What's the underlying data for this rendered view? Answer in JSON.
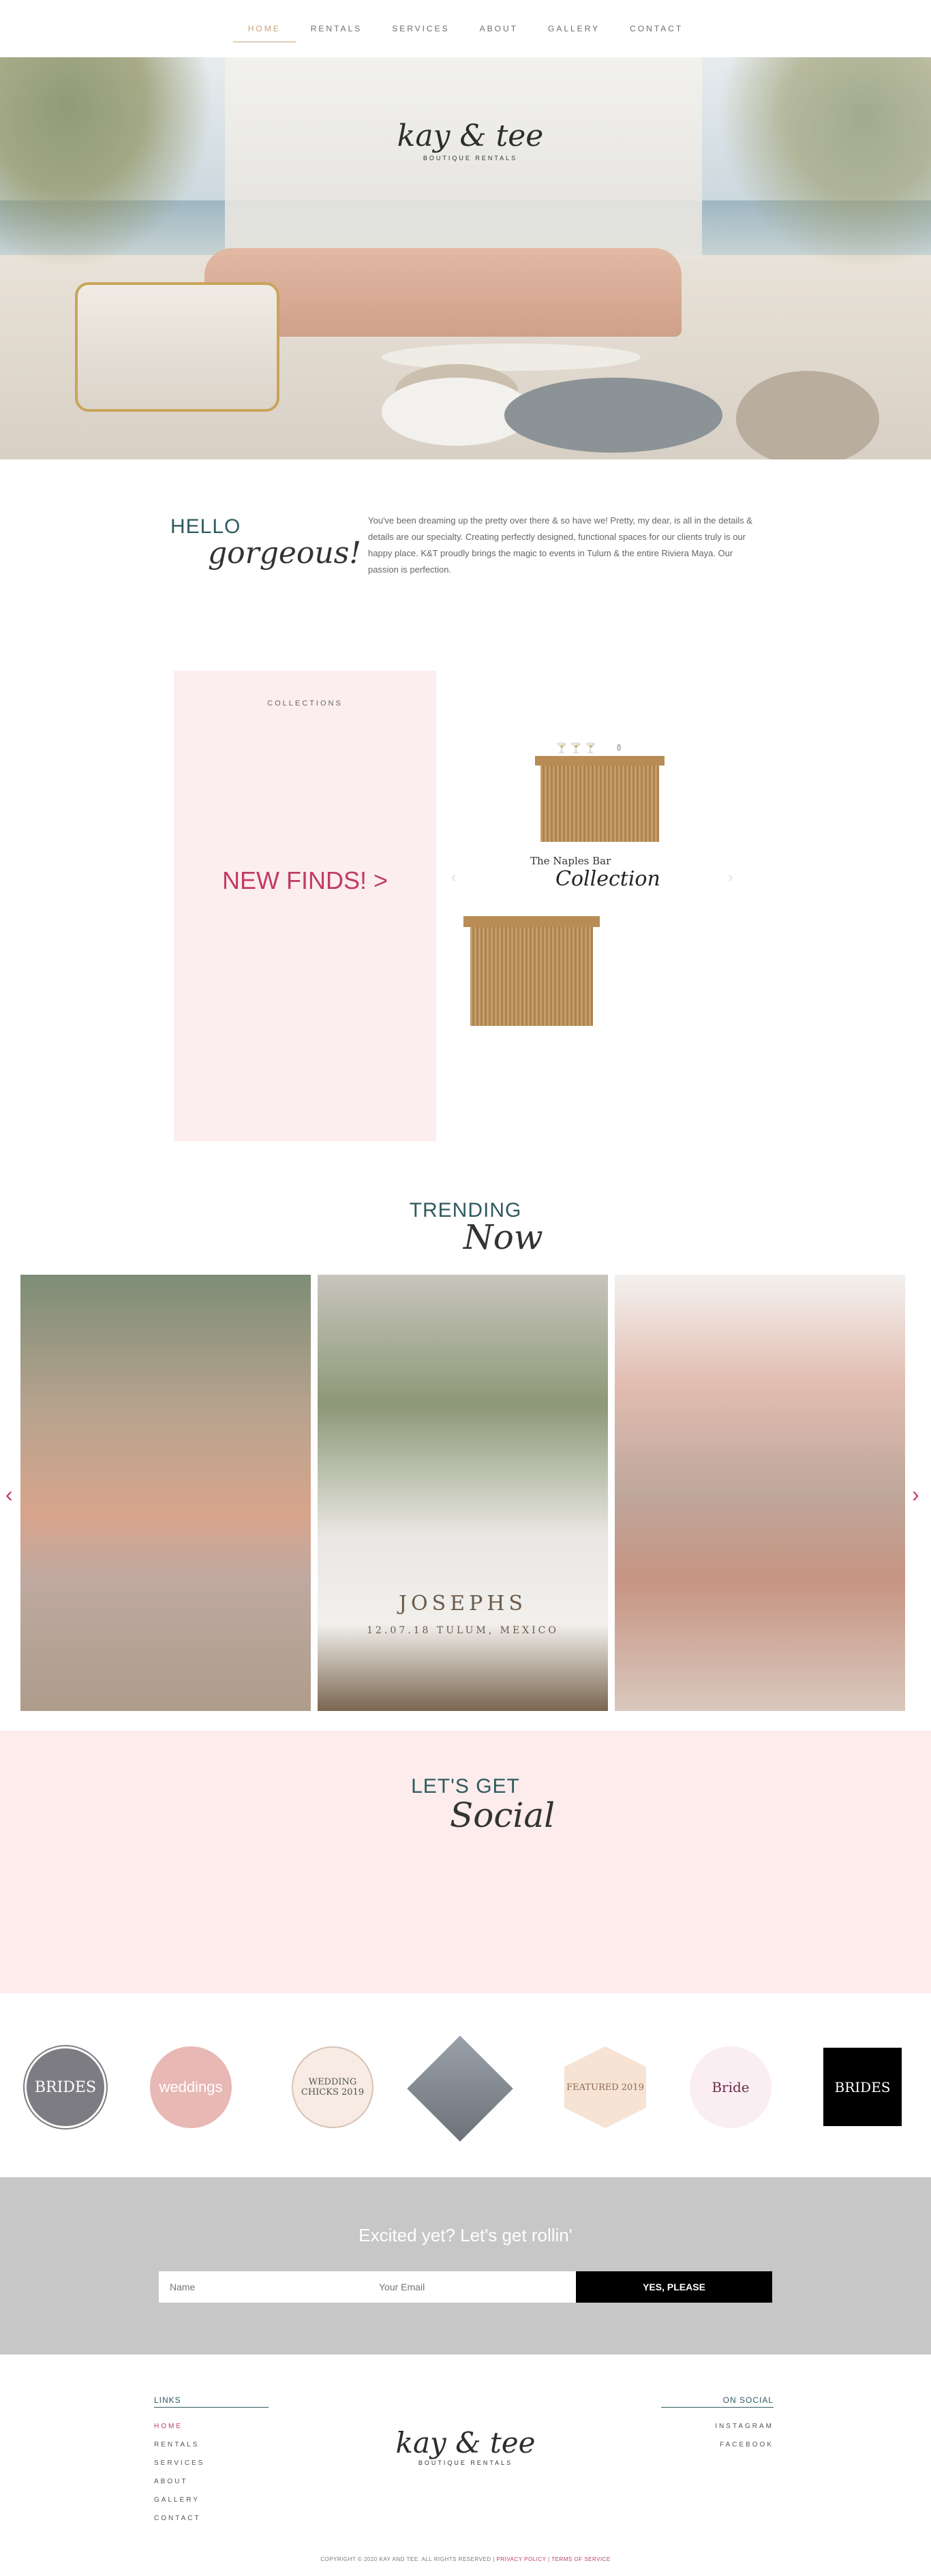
{
  "nav": {
    "items": [
      {
        "label": "HOME",
        "active": true
      },
      {
        "label": "RENTALS"
      },
      {
        "label": "SERVICES"
      },
      {
        "label": "ABOUT"
      },
      {
        "label": "GALLERY"
      },
      {
        "label": "CONTACT"
      }
    ]
  },
  "hero": {
    "logo_script": "kay & tee",
    "logo_sub": "BOUTIQUE RENTALS"
  },
  "hello": {
    "title": "HELLO",
    "script": "gorgeous!",
    "body": "You've been dreaming up the pretty over there & so have we! Pretty, my dear, is all in the details & details are our specialty. Creating perfectly designed, functional spaces for our clients truly is our happy place. K&T proudly brings the magic to events in Tulum & the entire Riviera Maya. Our passion is perfection."
  },
  "collections": {
    "label": "COLLECTIONS",
    "cta": "NEW FINDS! >",
    "item_title": "The Naples Bar",
    "item_script": "Collection",
    "prev_icon": "chevron-left-icon",
    "next_icon": "chevron-right-icon"
  },
  "trending": {
    "title": "TRENDING",
    "script": "Now",
    "photo2_caption": "JOSEPHS",
    "photo2_sub": "12.07.18  TULUM, MEXICO"
  },
  "social": {
    "title": "LET'S GET",
    "script": "Social"
  },
  "badges": [
    {
      "name": "as-featured-on-brides",
      "text": "BRIDES"
    },
    {
      "name": "martha-stewart-weddings",
      "text": "weddings"
    },
    {
      "name": "wedding-chicks-2019",
      "text": "WEDDING CHICKS 2019"
    },
    {
      "name": "vendor-badge",
      "text": ""
    },
    {
      "name": "featured-vendor-2019",
      "text": "FEATURED 2019"
    },
    {
      "name": "featured-in-bride",
      "text": "Bride"
    },
    {
      "name": "featured-on-brides-wedding-of-the-day",
      "text": "BRIDES"
    }
  ],
  "signup": {
    "question": "Excited yet? Let's get rollin'",
    "name_placeholder": "Name",
    "email_placeholder": "Your Email",
    "button": "YES, PLEASE"
  },
  "footer": {
    "links_heading": "LINKS",
    "social_heading": "ON SOCIAL",
    "links": [
      {
        "label": "HOME",
        "active": true
      },
      {
        "label": "RENTALS"
      },
      {
        "label": "SERVICES"
      },
      {
        "label": "ABOUT"
      },
      {
        "label": "GALLERY"
      },
      {
        "label": "CONTACT"
      }
    ],
    "social_links": [
      {
        "label": "INSTAGRAM"
      },
      {
        "label": "FACEBOOK"
      }
    ],
    "logo_script": "kay & tee",
    "logo_sub": "BOUTIQUE RENTALS",
    "copyright": "COPYRIGHT © 2020 KAY AND TEE. ALL RIGHTS RESERVED | ",
    "privacy": "PRIVACY POLICY",
    "sep": " | ",
    "terms": "TERMS OF SERVICE"
  },
  "colors": {
    "accent_pink": "#c23b66",
    "teal": "#2f5a5e",
    "blush": "#fcecec",
    "gold": "#c9a27a"
  }
}
